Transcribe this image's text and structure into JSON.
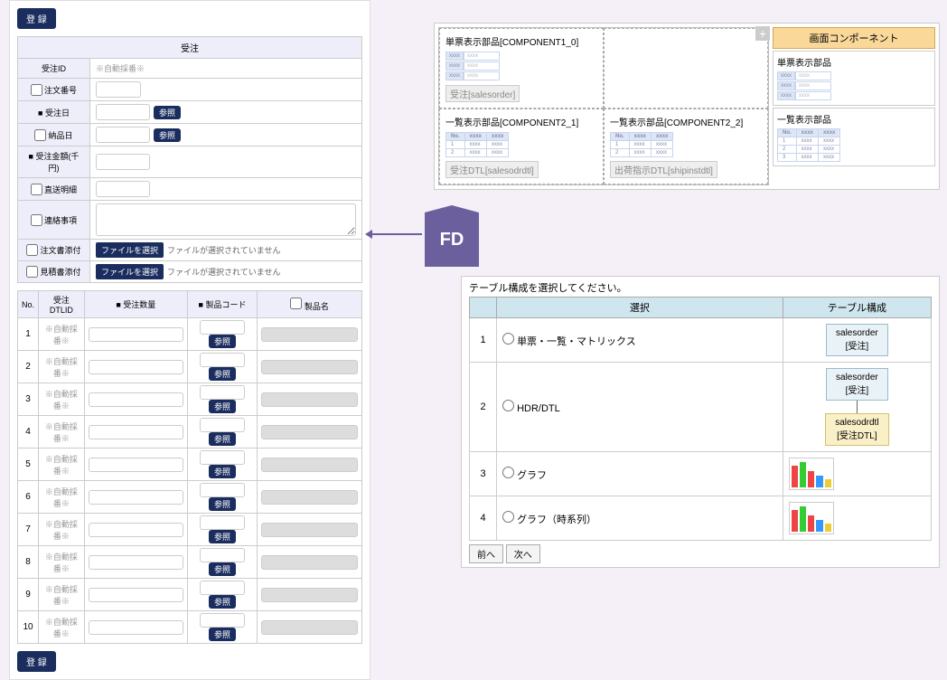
{
  "buttons": {
    "register": "登 録",
    "ref": "参照",
    "file": "ファイルを選択",
    "prev": "前へ",
    "next": "次へ"
  },
  "form": {
    "title": "受注",
    "auto_num": "※自動採番※",
    "file_none": "ファイルが選択されていません",
    "rows": {
      "order_id": "受注ID",
      "order_no": "注文番号",
      "order_date": "受注日",
      "delivery_date": "納品日",
      "amount": "受注金額(千円)",
      "ship_detail": "直送明細",
      "contact": "連絡事項",
      "order_attach": "注文書添付",
      "quote_attach": "見積書添付"
    }
  },
  "detail": {
    "cols": {
      "no": "No.",
      "dtl_id": "受注DTLID",
      "qty": "受注数量",
      "prod_code": "製品コード",
      "prod_name": "製品名"
    },
    "rows": [
      1,
      2,
      3,
      4,
      5,
      6,
      7,
      8,
      9,
      10
    ]
  },
  "fd": "FD",
  "designer": {
    "cells": {
      "c1": {
        "title": "単票表示部品[COMPONENT1_0]",
        "chip": "受注[salesorder]"
      },
      "c2": {
        "title": ""
      },
      "c3": {
        "title": "一覧表示部品[COMPONENT2_1]",
        "chip": "受注DTL[salesodrdtl]"
      },
      "c4": {
        "title": "一覧表示部品[COMPONENT2_2]",
        "chip": "出荷指示DTL[shipinstdtl]"
      }
    },
    "palette_title": "画面コンポーネント",
    "palette_items": {
      "single": "単票表示部品",
      "list": "一覧表示部品"
    }
  },
  "wizard": {
    "instruction": "テーブル構成を選択してください。",
    "cols": {
      "choice": "選択",
      "tbl": "テーブル構成"
    },
    "rows": {
      "r1": {
        "no": "1",
        "label": "単票・一覧・マトリックス",
        "e1": "salesorder",
        "e1s": "[受注]"
      },
      "r2": {
        "no": "2",
        "label": "HDR/DTL",
        "e1": "salesorder",
        "e1s": "[受注]",
        "e2": "salesodrdtl",
        "e2s": "[受注DTL]"
      },
      "r3": {
        "no": "3",
        "label": "グラフ"
      },
      "r4": {
        "no": "4",
        "label": "グラフ（時系列）"
      }
    }
  }
}
